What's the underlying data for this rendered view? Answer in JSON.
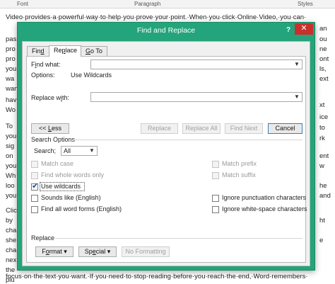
{
  "background": {
    "ribbon": {
      "font": "Font",
      "paragraph": "Paragraph",
      "styles": "Styles"
    },
    "doc_lines": [
      "Video·provides·a·powerful·way·to·help·you·prove·your·point.·When·you·click·Online·Video,·you·can·",
      "focus·on·the·text·you·want.·If·you·need·to·stop·reading·before·you·reach·the·end,·Word·remembers·"
    ],
    "left_fragments": [
      "pas",
      "pro",
      "pro",
      "you",
      "wa",
      "wan",
      "hav",
      "Wo",
      "To",
      "you",
      "sig",
      "on",
      "you",
      "Wh",
      "loo",
      "you",
      "Clic",
      "by",
      "cha",
      "she",
      "cha",
      "nex",
      "the",
      "plu"
    ],
    "right_fragments": [
      "an",
      "ou",
      "ne",
      "ont",
      "ls,",
      "ext",
      "xt",
      "ice",
      "to",
      "rk",
      "ent",
      "w",
      "he",
      "and",
      "ht",
      "e"
    ]
  },
  "dialog": {
    "title": "Find and Replace",
    "help_label": "?",
    "close_label": "✕",
    "tabs": [
      {
        "label": "Find",
        "accel": "d"
      },
      {
        "label": "Replace",
        "accel": "p"
      },
      {
        "label": "Go To",
        "accel": "G"
      }
    ],
    "find_what_label": "Find what:",
    "options_label": "Options:",
    "options_value": "Use Wildcards",
    "find_what_value": "",
    "replace_with_label": "Replace with:",
    "replace_with_value": "",
    "buttons": {
      "less": "<< Less",
      "replace": "Replace",
      "replace_all": "Replace All",
      "find_next": "Find Next",
      "cancel": "Cancel"
    },
    "search_options_title": "Search Options",
    "search_label": "Search;",
    "search_value": "All",
    "checkboxes_left": [
      {
        "label": "Match case",
        "checked": false,
        "enabled": false
      },
      {
        "label": "Find whole words only",
        "checked": false,
        "enabled": false
      },
      {
        "label": "Use wildcards",
        "checked": true,
        "enabled": true
      },
      {
        "label": "Sounds like (English)",
        "checked": false,
        "enabled": true
      },
      {
        "label": "Find all word forms (English)",
        "checked": false,
        "enabled": true
      }
    ],
    "checkboxes_right": [
      {
        "label": "Match prefix",
        "checked": false,
        "enabled": false
      },
      {
        "label": "Match suffix",
        "checked": false,
        "enabled": false
      },
      {
        "label": "Ignore punctuation characters",
        "checked": false,
        "enabled": true
      },
      {
        "label": "Ignore white-space characters",
        "checked": false,
        "enabled": true
      }
    ],
    "replace_section_title": "Replace",
    "format_button": "Format ▾",
    "special_button": "Special ▾",
    "no_formatting_button": "No Formatting"
  }
}
